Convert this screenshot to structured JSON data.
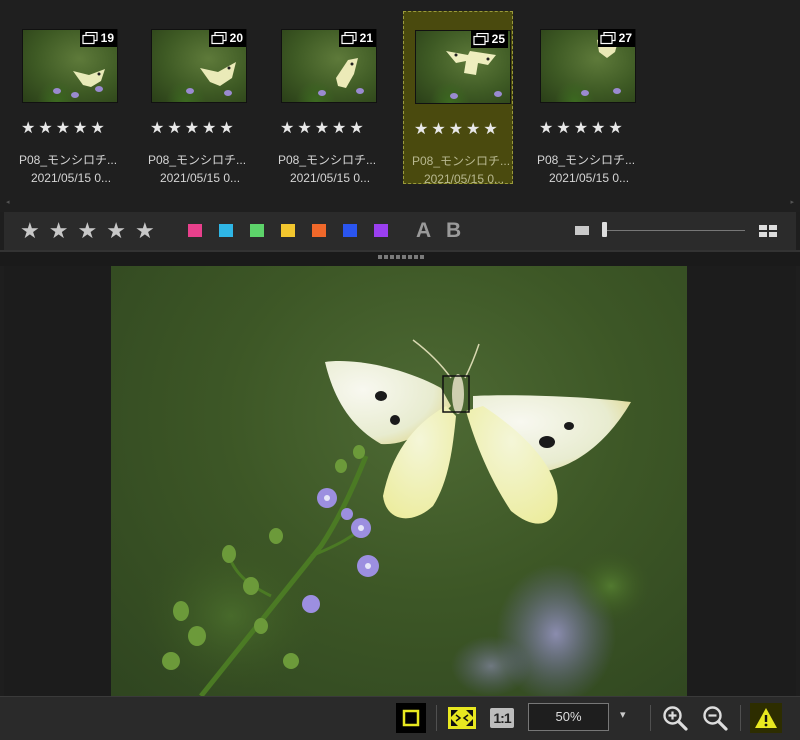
{
  "filmstrip": {
    "thumbnails": [
      {
        "stack_count": "19",
        "rating": "★★★★★",
        "name": "P08_モンシロチ...",
        "date": "2021/05/15 0...",
        "selected": false
      },
      {
        "stack_count": "20",
        "rating": "★★★★★",
        "name": "P08_モンシロチ...",
        "date": "2021/05/15 0...",
        "selected": false
      },
      {
        "stack_count": "21",
        "rating": "★★★★★",
        "name": "P08_モンシロチ...",
        "date": "2021/05/15 0...",
        "selected": false
      },
      {
        "stack_count": "25",
        "rating": "★★★★★",
        "name": "P08_モンシロチ...",
        "date": "2021/05/15 0...",
        "selected": true
      },
      {
        "stack_count": "27",
        "rating": "★★★★★",
        "name": "P08_モンシロチ...",
        "date": "2021/05/15 0...",
        "selected": false
      }
    ],
    "stack_icon": "stack-icon",
    "scroll_left": "◂",
    "scroll_right": "▸"
  },
  "toolbar": {
    "rating_stars": [
      "★",
      "★",
      "★",
      "★",
      "★"
    ],
    "color_labels": [
      "#e8408c",
      "#2fb6e6",
      "#5dd36a",
      "#f2c62e",
      "#f0682a",
      "#2a55f0",
      "#9a3ff0"
    ],
    "label_a": "A",
    "label_b": "B",
    "thumbnail_size_slider": 0.0,
    "view_icon": "grid-view-icon"
  },
  "viewer": {
    "image_icon": "butterfly-photo"
  },
  "bottombar": {
    "zoom_value": "50%",
    "zoom_dropdown": "▾",
    "one_to_one": "1:1",
    "accent_color": "#e8e820",
    "warning_color": "#2d2d00"
  }
}
